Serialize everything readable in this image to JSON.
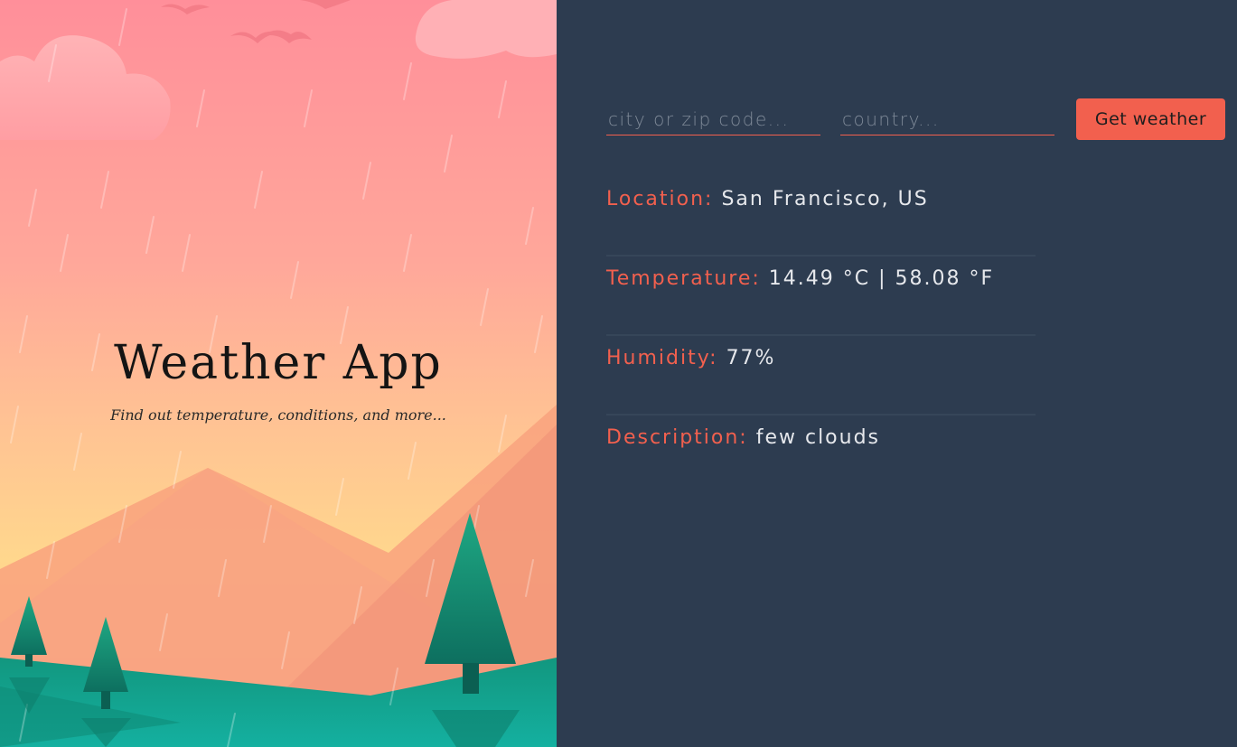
{
  "hero": {
    "title": "Weather App",
    "subtitle": "Find out temperature, conditions, and more..."
  },
  "form": {
    "city_placeholder": "city or zip code...",
    "city_value": "",
    "country_placeholder": "country...",
    "country_value": "",
    "submit_label": "Get weather"
  },
  "weather": {
    "location_label": "Location:",
    "location_value": "San Francisco, US",
    "temperature_label": "Temperature:",
    "temperature_value": "14.49 °C | 58.08 °F",
    "humidity_label": "Humidity:",
    "humidity_value": "77%",
    "description_label": "Description:",
    "description_value": "few clouds"
  },
  "colors": {
    "accent": "#f2604e",
    "panel_background": "#2d3c50",
    "divider": "#364659",
    "value_text": "#e6e8ec"
  },
  "icons": [
    "bird-icon",
    "cloud-icon",
    "pine-tree-icon"
  ]
}
